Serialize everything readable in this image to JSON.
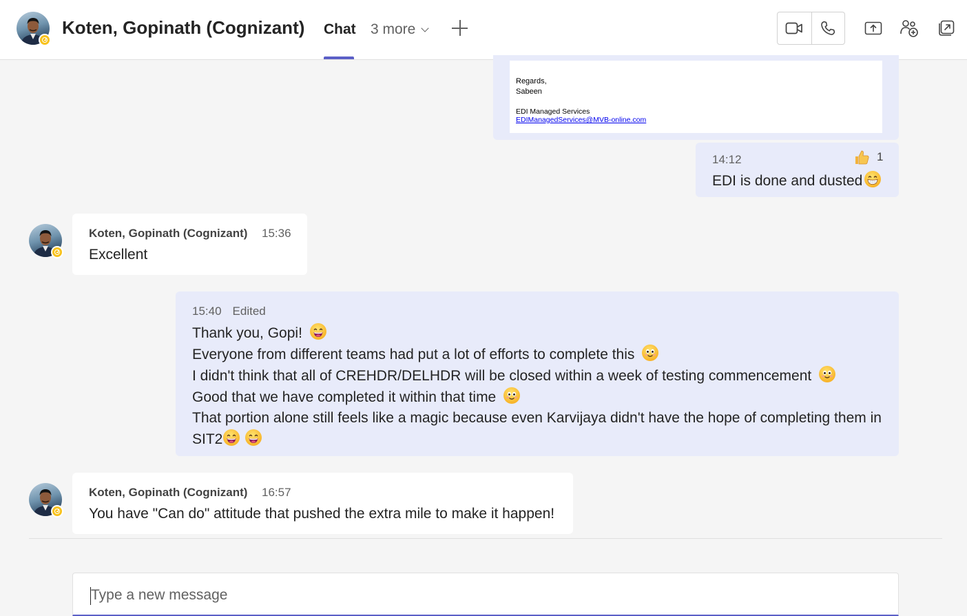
{
  "header": {
    "title": "Koten, Gopinath (Cognizant)",
    "tab_chat": "Chat",
    "tab_more": "3 more"
  },
  "messages": {
    "email": {
      "regards": "Regards,",
      "name": "Sabeen",
      "team": "EDI Managed Services",
      "email_link": "EDIManagedServices@MVB-online.com"
    },
    "m1": {
      "time": "14:12",
      "reaction_count": "1",
      "text": "EDI is done and dusted"
    },
    "m2": {
      "sender": "Koten, Gopinath (Cognizant)",
      "time": "15:36",
      "text": "Excellent"
    },
    "m3": {
      "time": "15:40",
      "edited": "Edited",
      "line1": "Thank you, Gopi!",
      "line2": "Everyone from different teams had put a lot of efforts to complete this",
      "line3": "I didn't think that all of CREHDR/DELHDR will be closed within a week of testing commencement",
      "line4": "Good that we have completed it within that time",
      "line5a": "That portion alone still feels like a magic because even Karvijaya didn't have the hope of completing them in",
      "line5b": "SIT2"
    },
    "m4": {
      "sender": "Koten, Gopinath (Cognizant)",
      "time": "16:57",
      "text": "You have \"Can do\" attitude that pushed the extra mile to make it happen!"
    }
  },
  "composer": {
    "placeholder": "Type a new message"
  },
  "colors": {
    "accent": "#5b5fc7",
    "self_bubble": "#e8ebfa",
    "presence_away": "#f8c21c"
  },
  "icons": [
    "video-call-icon",
    "audio-call-icon",
    "share-screen-icon",
    "add-people-icon",
    "pop-out-icon",
    "grinning-emoji-icon",
    "smiling-emoji-icon",
    "beaming-emoji-icon",
    "thumbs-up-icon",
    "clock-icon"
  ]
}
